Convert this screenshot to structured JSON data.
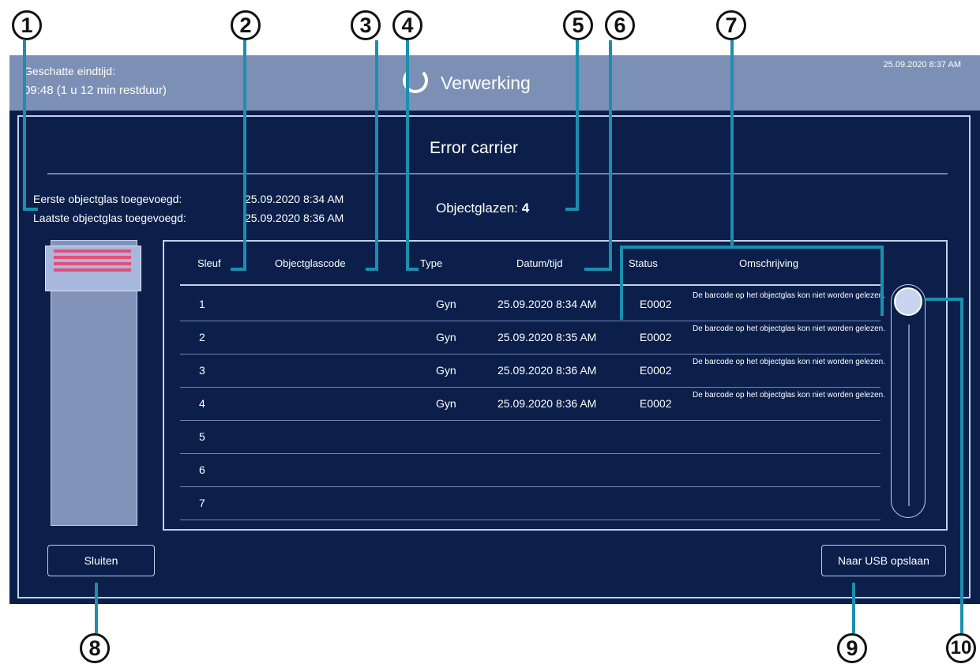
{
  "callouts": [
    "1",
    "2",
    "3",
    "4",
    "5",
    "6",
    "7",
    "8",
    "9",
    "10"
  ],
  "topbar": {
    "eta_label": "Geschatte eindtijd:",
    "eta_value": "09:48 (1 u 12 min restduur)",
    "status_title": "Verwerking",
    "clock": "25.09.2020 8:37 AM"
  },
  "dialog": {
    "title": "Error carrier",
    "first_label": "Eerste objectglas toegevoegd:",
    "first_value": "25.09.2020 8:34 AM",
    "last_label": "Laatste objectglas toegevoegd:",
    "last_value": "25.09.2020 8:36 AM",
    "count_label": "Objectglazen:",
    "count_value": "4"
  },
  "table": {
    "headers": {
      "slot": "Sleuf",
      "code": "Objectglascode",
      "type": "Type",
      "datetime": "Datum/tijd",
      "status": "Status",
      "description": "Omschrijving"
    },
    "rows": [
      {
        "slot": "1",
        "code": "",
        "type": "Gyn",
        "datetime": "25.09.2020 8:34 AM",
        "status": "E0002",
        "description": "De barcode op het objectglas kon niet worden gelezen."
      },
      {
        "slot": "2",
        "code": "",
        "type": "Gyn",
        "datetime": "25.09.2020 8:35 AM",
        "status": "E0002",
        "description": "De barcode op het objectglas kon niet worden gelezen."
      },
      {
        "slot": "3",
        "code": "",
        "type": "Gyn",
        "datetime": "25.09.2020 8:36 AM",
        "status": "E0002",
        "description": "De barcode op het objectglas kon niet worden gelezen."
      },
      {
        "slot": "4",
        "code": "",
        "type": "Gyn",
        "datetime": "25.09.2020 8:36 AM",
        "status": "E0002",
        "description": "De barcode op het objectglas kon niet worden gelezen."
      },
      {
        "slot": "5",
        "code": "",
        "type": "",
        "datetime": "",
        "status": "",
        "description": ""
      },
      {
        "slot": "6",
        "code": "",
        "type": "",
        "datetime": "",
        "status": "",
        "description": ""
      },
      {
        "slot": "7",
        "code": "",
        "type": "",
        "datetime": "",
        "status": "",
        "description": ""
      }
    ]
  },
  "carrier": {
    "occupied_slots": 4,
    "bar_color": "#e2507a"
  },
  "scrollbar": {
    "position": 0
  },
  "buttons": {
    "close": "Sluiten",
    "usb": "Naar USB opslaan"
  },
  "colors": {
    "background": "#0b1f4a",
    "topbar": "#7c8fb5",
    "callout_line": "#1b8fb0",
    "border": "#c4d0e8"
  }
}
